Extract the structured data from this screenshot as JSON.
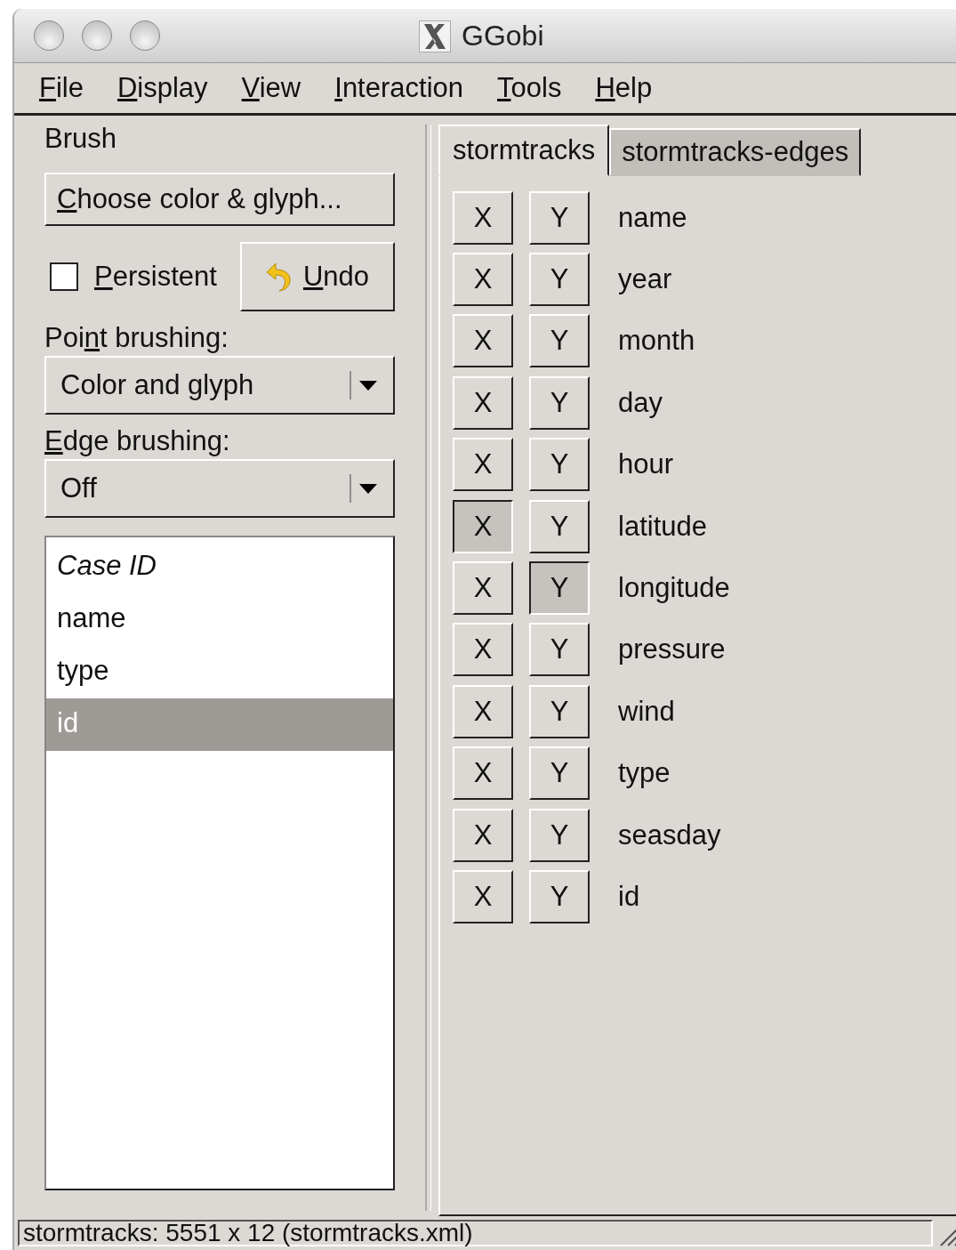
{
  "window": {
    "title": "GGobi"
  },
  "menu": [
    {
      "key": "F",
      "post": "ile"
    },
    {
      "key": "D",
      "post": "isplay"
    },
    {
      "key": "V",
      "post": "iew"
    },
    {
      "key": "I",
      "post": "nteraction"
    },
    {
      "key": "T",
      "post": "ools"
    },
    {
      "key": "H",
      "post": "elp"
    }
  ],
  "brush": {
    "heading": "Brush",
    "choose_button": {
      "key": "C",
      "post": "hoose color & glyph..."
    },
    "persistent": {
      "label": {
        "key": "P",
        "post": "ersistent"
      },
      "checked": false
    },
    "undo_button": {
      "key": "U",
      "post": "ndo"
    },
    "point_brushing": {
      "label": {
        "pre": "Poi",
        "key": "n",
        "post": "t brushing:"
      },
      "value": "Color and glyph"
    },
    "edge_brushing": {
      "label": {
        "key": "E",
        "post": "dge brushing:"
      },
      "value": "Off"
    },
    "list": [
      {
        "text": "Case ID",
        "kind": "header",
        "selected": false
      },
      {
        "text": "name",
        "kind": "item",
        "selected": false
      },
      {
        "text": "type",
        "kind": "item",
        "selected": false
      },
      {
        "text": "id",
        "kind": "item",
        "selected": true
      }
    ]
  },
  "tabs": [
    {
      "label": "stormtracks",
      "selected": true
    },
    {
      "label": "stormtracks-edges",
      "selected": false
    }
  ],
  "variables": [
    {
      "name": "name",
      "x_label": "X",
      "y_label": "Y",
      "x": false,
      "y": false
    },
    {
      "name": "year",
      "x_label": "X",
      "y_label": "Y",
      "x": false,
      "y": false
    },
    {
      "name": "month",
      "x_label": "X",
      "y_label": "Y",
      "x": false,
      "y": false
    },
    {
      "name": "day",
      "x_label": "X",
      "y_label": "Y",
      "x": false,
      "y": false
    },
    {
      "name": "hour",
      "x_label": "X",
      "y_label": "Y",
      "x": false,
      "y": false
    },
    {
      "name": "latitude",
      "x_label": "X",
      "y_label": "Y",
      "x": true,
      "y": false
    },
    {
      "name": "longitude",
      "x_label": "X",
      "y_label": "Y",
      "x": false,
      "y": true
    },
    {
      "name": "pressure",
      "x_label": "X",
      "y_label": "Y",
      "x": false,
      "y": false
    },
    {
      "name": "wind",
      "x_label": "X",
      "y_label": "Y",
      "x": false,
      "y": false
    },
    {
      "name": "type",
      "x_label": "X",
      "y_label": "Y",
      "x": false,
      "y": false
    },
    {
      "name": "seasday",
      "x_label": "X",
      "y_label": "Y",
      "x": false,
      "y": false
    },
    {
      "name": "id",
      "x_label": "X",
      "y_label": "Y",
      "x": false,
      "y": false
    }
  ],
  "status_bar": "stormtracks: 5551 x 12  (stormtracks.xml)"
}
